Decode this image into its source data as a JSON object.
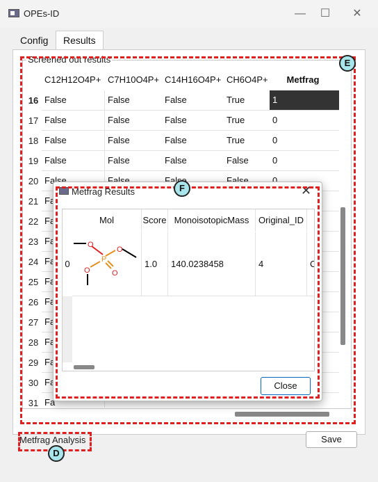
{
  "window": {
    "title": "OPEs-ID",
    "minimize_glyph": "—",
    "maximize_glyph": "☐",
    "close_glyph": "✕"
  },
  "tabs": [
    {
      "label": "Config"
    },
    {
      "label": "Results"
    }
  ],
  "results": {
    "group_title": "Screened out results",
    "columns": [
      "C12H12O4P+",
      "C7H10O4P+",
      "C14H16O4P+",
      "CH6O4P+",
      "Metfrag"
    ],
    "rows": [
      {
        "index": "16",
        "cells": [
          "False",
          "False",
          "False",
          "True",
          "1"
        ]
      },
      {
        "index": "17",
        "cells": [
          "False",
          "False",
          "False",
          "True",
          "0"
        ]
      },
      {
        "index": "18",
        "cells": [
          "False",
          "False",
          "False",
          "True",
          "0"
        ]
      },
      {
        "index": "19",
        "cells": [
          "False",
          "False",
          "False",
          "False",
          "0"
        ]
      },
      {
        "index": "20",
        "cells": [
          "False",
          "False",
          "False",
          "False",
          "0"
        ]
      },
      {
        "index": "21",
        "cells": [
          "Fa",
          "",
          "",
          "",
          ""
        ]
      },
      {
        "index": "22",
        "cells": [
          "Fa",
          "",
          "",
          "",
          ""
        ]
      },
      {
        "index": "23",
        "cells": [
          "Fa",
          "",
          "",
          "",
          ""
        ]
      },
      {
        "index": "24",
        "cells": [
          "Fa",
          "",
          "",
          "",
          ""
        ]
      },
      {
        "index": "25",
        "cells": [
          "Fa",
          "",
          "",
          "",
          ""
        ]
      },
      {
        "index": "26",
        "cells": [
          "Fa",
          "",
          "",
          "",
          ""
        ]
      },
      {
        "index": "27",
        "cells": [
          "Fa",
          "",
          "",
          "",
          ""
        ]
      },
      {
        "index": "28",
        "cells": [
          "Fa",
          "",
          "",
          "",
          ""
        ]
      },
      {
        "index": "29",
        "cells": [
          "Fa",
          "",
          "",
          "",
          ""
        ]
      },
      {
        "index": "30",
        "cells": [
          "Fa",
          "",
          "",
          "",
          ""
        ]
      },
      {
        "index": "31",
        "cells": [
          "Fa",
          "",
          "",
          "",
          ""
        ]
      }
    ]
  },
  "dialog": {
    "title": "Metfrag Results",
    "close_glyph": "✕",
    "columns": [
      "Mol",
      "Score",
      "MonoisotopicMass",
      "Original_ID"
    ],
    "row": {
      "index": "0",
      "score": "1.0",
      "mass": "140.0238458",
      "original_id": "4",
      "clipped": "C"
    },
    "close_button": "Close"
  },
  "footer": {
    "analysis_label": "Metfrag Analysis",
    "save_button": "Save"
  },
  "annotations": {
    "D": "D",
    "E": "E",
    "F": "F"
  },
  "colors": {
    "annotation_dash": "#e02020",
    "badge_fill": "#a8e6ec",
    "selected_cell": "#333333"
  }
}
